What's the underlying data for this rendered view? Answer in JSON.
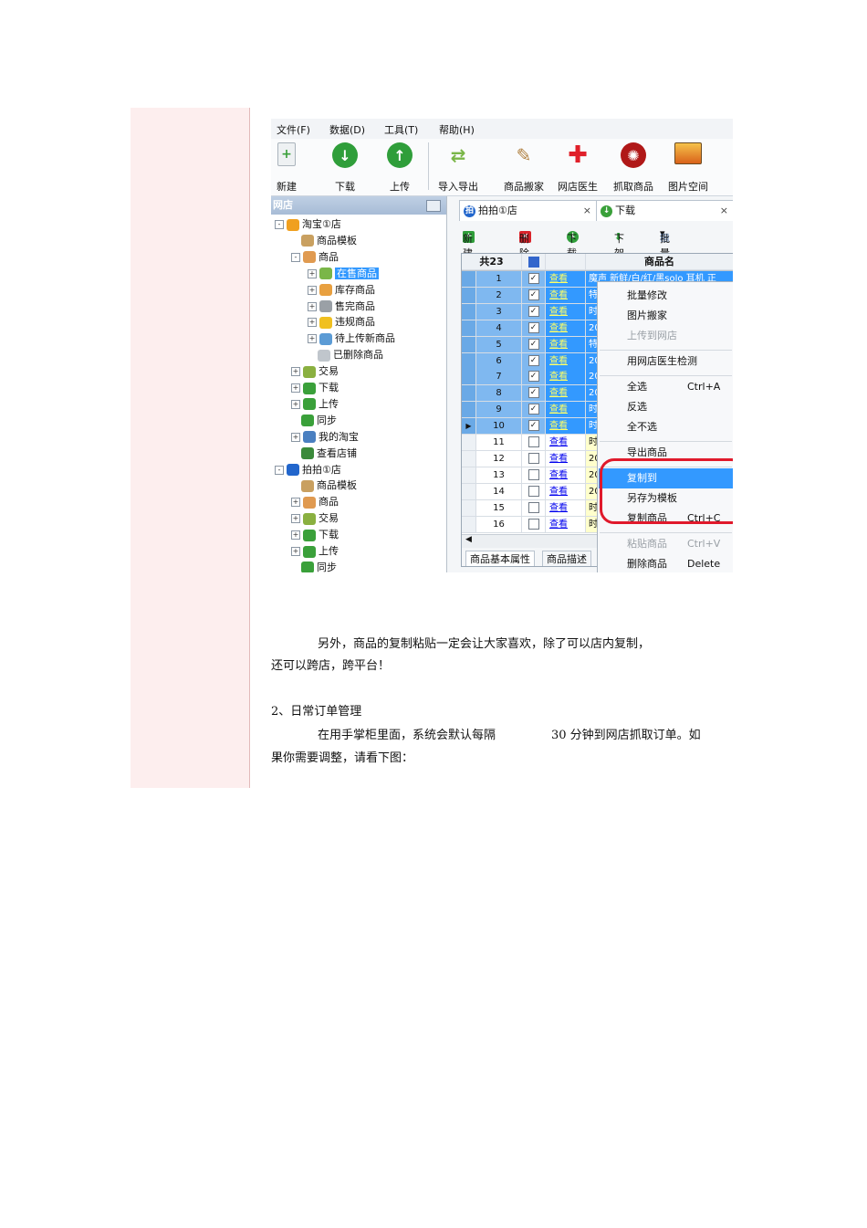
{
  "menu": [
    "文件(F)",
    "数据(D)",
    "工具(T)",
    "帮助(H)"
  ],
  "toolbar": [
    "新建",
    "下载",
    "上传",
    "导入导出",
    "商品搬家",
    "网店医生",
    "抓取商品",
    "图片空间"
  ],
  "tree": {
    "header": "网店",
    "nodes": [
      {
        "label": "淘宝①店",
        "level": 0,
        "exp": "-",
        "icon": "smile-shop-icon",
        "color": "#f0a020"
      },
      {
        "label": "商品模板",
        "level": 1,
        "exp": "",
        "icon": "template-icon",
        "color": "#c9a060"
      },
      {
        "label": "商品",
        "level": 1,
        "exp": "-",
        "icon": "box-icon",
        "color": "#e09a50"
      },
      {
        "label": "在售商品",
        "level": 2,
        "exp": "+",
        "icon": "tag-icon",
        "color": "#7ab648",
        "selected": true
      },
      {
        "label": "库存商品",
        "level": 2,
        "exp": "+",
        "icon": "stock-icon",
        "color": "#e8a040"
      },
      {
        "label": "售完商品",
        "level": 2,
        "exp": "+",
        "icon": "soldout-icon",
        "color": "#9aa0a6"
      },
      {
        "label": "违规商品",
        "level": 2,
        "exp": "+",
        "icon": "warning-icon",
        "color": "#f0c020"
      },
      {
        "label": "待上传新商品",
        "level": 2,
        "exp": "+",
        "icon": "pending-icon",
        "color": "#5b9bd5"
      },
      {
        "label": "已删除商品",
        "level": 2,
        "exp": "",
        "icon": "trash-icon",
        "color": "#c0c6cc"
      },
      {
        "label": "交易",
        "level": 1,
        "exp": "+",
        "icon": "trade-icon",
        "color": "#8ab040"
      },
      {
        "label": "下载",
        "level": 1,
        "exp": "+",
        "icon": "download-icon",
        "color": "#3aa03a"
      },
      {
        "label": "上传",
        "level": 1,
        "exp": "+",
        "icon": "upload-icon",
        "color": "#3aa03a"
      },
      {
        "label": "同步",
        "level": 1,
        "exp": "",
        "icon": "sync-icon",
        "color": "#3aa03a"
      },
      {
        "label": "我的淘宝",
        "level": 1,
        "exp": "+",
        "icon": "network-icon",
        "color": "#4a7fc0"
      },
      {
        "label": "查看店铺",
        "level": 1,
        "exp": "",
        "icon": "globe-icon",
        "color": "#3a8a3a"
      },
      {
        "label": "拍拍①店",
        "level": 0,
        "exp": "-",
        "icon": "paipai-icon",
        "color": "#2266cc"
      },
      {
        "label": "商品模板",
        "level": 1,
        "exp": "",
        "icon": "template-icon",
        "color": "#c9a060"
      },
      {
        "label": "商品",
        "level": 1,
        "exp": "+",
        "icon": "box-icon",
        "color": "#e09a50"
      },
      {
        "label": "交易",
        "level": 1,
        "exp": "+",
        "icon": "trade-icon",
        "color": "#8ab040"
      },
      {
        "label": "下载",
        "level": 1,
        "exp": "+",
        "icon": "download-icon",
        "color": "#3aa03a"
      },
      {
        "label": "上传",
        "level": 1,
        "exp": "+",
        "icon": "upload-icon",
        "color": "#3aa03a"
      },
      {
        "label": "同步",
        "level": 1,
        "exp": "",
        "icon": "sync-icon",
        "color": "#3aa03a"
      }
    ]
  },
  "tabs": [
    {
      "label": "拍拍①店",
      "glyph": "拍",
      "color": "#2266cc"
    },
    {
      "label": "下载",
      "glyph": "↓",
      "color": "#3aa03a"
    }
  ],
  "subtoolbar": [
    "新建",
    "删除",
    "下载",
    "下架",
    "批量修改"
  ],
  "grid": {
    "count_label": "共23",
    "name_header": "商品名",
    "view_label": "查看",
    "rows": [
      {
        "n": "1",
        "checked": true,
        "name": "魔声 新鲜/白/红/黑solo 耳机 正"
      },
      {
        "n": "2",
        "checked": true,
        "name": "特"
      },
      {
        "n": "3",
        "checked": true,
        "name": "时"
      },
      {
        "n": "4",
        "checked": true,
        "name": "20"
      },
      {
        "n": "5",
        "checked": true,
        "name": "特"
      },
      {
        "n": "6",
        "checked": true,
        "name": "20"
      },
      {
        "n": "7",
        "checked": true,
        "name": "20"
      },
      {
        "n": "8",
        "checked": true,
        "name": "20"
      },
      {
        "n": "9",
        "checked": true,
        "name": "时"
      },
      {
        "n": "10",
        "checked": true,
        "name": "时",
        "current": true
      },
      {
        "n": "11",
        "checked": false,
        "name": "时"
      },
      {
        "n": "12",
        "checked": false,
        "name": "20"
      },
      {
        "n": "13",
        "checked": false,
        "name": "20"
      },
      {
        "n": "14",
        "checked": false,
        "name": "20"
      },
      {
        "n": "15",
        "checked": false,
        "name": "时"
      },
      {
        "n": "16",
        "checked": false,
        "name": "时"
      }
    ]
  },
  "context_menu": [
    {
      "label": "批量修改",
      "shortcut": "",
      "enabled": true
    },
    {
      "label": "图片搬家",
      "shortcut": "",
      "enabled": true
    },
    {
      "label": "上传到网店",
      "shortcut": "",
      "enabled": false
    },
    {
      "sep": true
    },
    {
      "label": "用网店医生检测",
      "shortcut": "",
      "enabled": true
    },
    {
      "sep": true
    },
    {
      "label": "全选",
      "shortcut": "Ctrl+A",
      "enabled": true
    },
    {
      "label": "反选",
      "shortcut": "",
      "enabled": true
    },
    {
      "label": "全不选",
      "shortcut": "",
      "enabled": true
    },
    {
      "sep": true
    },
    {
      "label": "导出商品",
      "shortcut": "",
      "enabled": true
    },
    {
      "sep": true
    },
    {
      "label": "复制到",
      "shortcut": "",
      "enabled": true,
      "highlight": true
    },
    {
      "label": "另存为模板",
      "shortcut": "",
      "enabled": true
    },
    {
      "label": "复制商品",
      "shortcut": "Ctrl+C",
      "enabled": true
    },
    {
      "sep": true
    },
    {
      "label": "粘贴商品",
      "shortcut": "Ctrl+V",
      "enabled": false
    },
    {
      "label": "删除商品",
      "shortcut": "Delete",
      "enabled": true
    }
  ],
  "bottom_tabs": [
    "商品基本属性",
    "商品描述"
  ],
  "paragraphs": {
    "p1a": "另外，商品的复制粘贴一定会让大家喜欢，除了可以店内复制，",
    "p1b": "还可以跨店，跨平台！",
    "h2": "2、日常订单管理",
    "p2a": "在用手掌柜里面，系统会默认每隔",
    "p2num": "30 分钟到网店抓取订单。如",
    "p2b": "果你需要调整，请看下图："
  },
  "colors": {
    "selection": "#3399ff",
    "highlight_circle": "#e0192b",
    "band": "#fdeeee"
  }
}
